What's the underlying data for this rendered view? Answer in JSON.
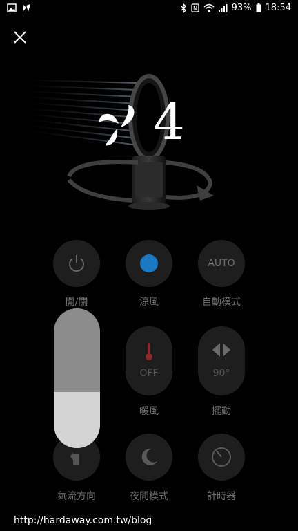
{
  "status_bar": {
    "battery": "93%",
    "time": "18:54"
  },
  "fan": {
    "speed": "4",
    "icons": [
      "fan-speed-icon"
    ]
  },
  "controls": {
    "power": {
      "label": "開/關"
    },
    "cool": {
      "label": "涼風",
      "accent": "#1b78c2"
    },
    "auto": {
      "label": "自動模式",
      "icon_text": "AUTO"
    },
    "heat": {
      "label": "暖風",
      "value": "OFF",
      "accent": "#8a2b2b"
    },
    "oscillate": {
      "label": "擺動",
      "value": "90°"
    },
    "airflow": {
      "label": "氣流方向"
    },
    "night": {
      "label": "夜間模式"
    },
    "timer": {
      "label": "計時器"
    }
  },
  "speed_slider": {
    "level_fraction": 0.4
  },
  "footer": {
    "url": "http://hardaway.com.tw/blog"
  }
}
